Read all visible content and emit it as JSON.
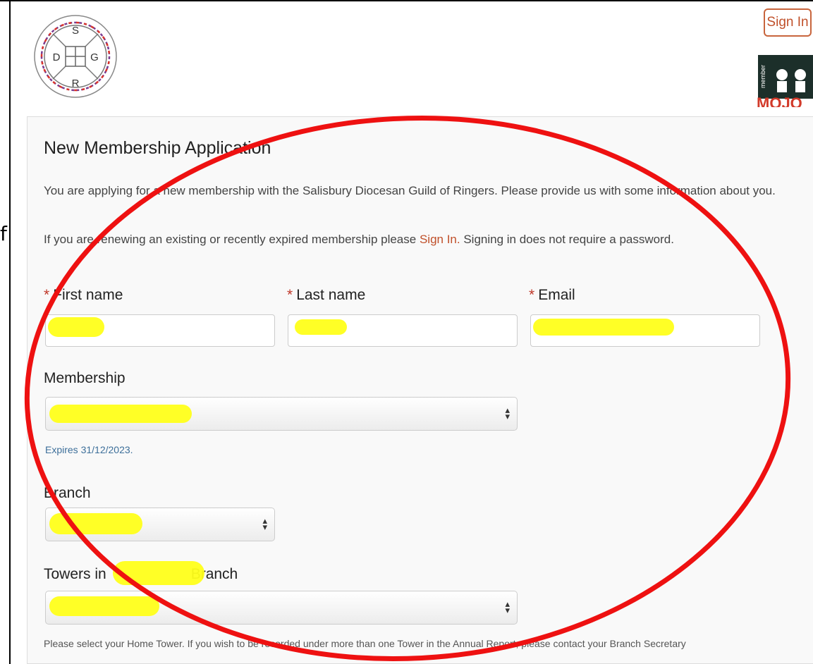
{
  "logo": {
    "letters": [
      "S",
      "D",
      "G",
      "R"
    ]
  },
  "header": {
    "signin_label": "Sign In",
    "mojo_text": "MOJO",
    "mojo_vertical": "member"
  },
  "stray_char": "f",
  "form": {
    "title": "New Membership Application",
    "intro": "You are applying for a new membership with the Salisbury Diocesan Guild of Ringers. Please provide us with some information about you.",
    "renew_prefix": "If you are renewing an existing or recently expired membership please ",
    "renew_link": "Sign In.",
    "renew_suffix": " Signing in does not require a password.",
    "first_name_label": "First name",
    "last_name_label": "Last name",
    "email_label": "Email",
    "required_marker": "*",
    "membership_label": "Membership",
    "membership_expires": "Expires 31/12/2023.",
    "branch_label": "Branch",
    "towers_label_prefix": "Towers in",
    "towers_label_suffix": "Branch",
    "home_tower_hint": "Please select your Home Tower. If you wish to be recorded under more than one Tower in the Annual Report, please contact your Branch Secretary"
  },
  "colors": {
    "annotation_ellipse": "#ee1111",
    "redaction_highlight": "#ffff1a",
    "link": "#c0502a"
  }
}
